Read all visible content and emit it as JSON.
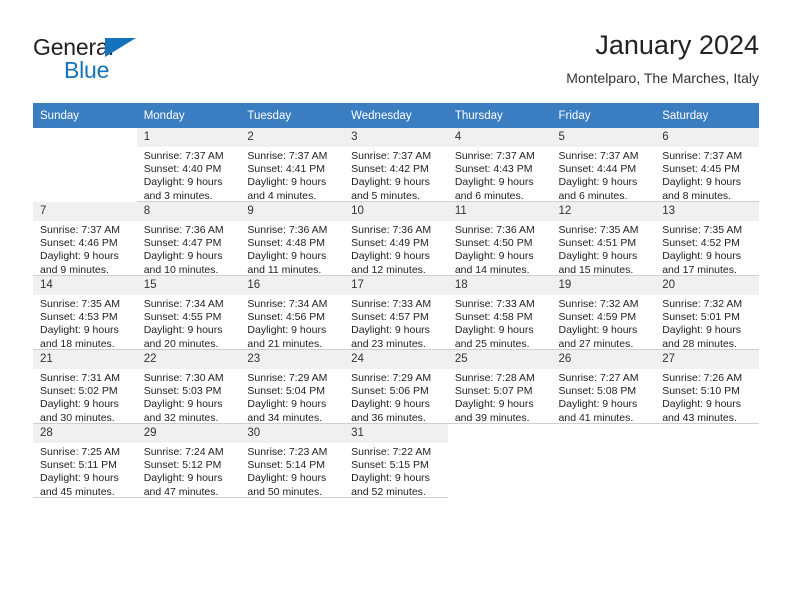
{
  "logo": {
    "word1": "General",
    "word2": "Blue"
  },
  "header": {
    "title": "January 2024",
    "subtitle": "Montelparo, The Marches, Italy"
  },
  "labels": {
    "sunrise_prefix": "Sunrise: ",
    "sunset_prefix": "Sunset: ",
    "daylight_prefix": "Daylight: "
  },
  "colors": {
    "header_blue": "#3a7dc0",
    "logo_blue": "#1673bb",
    "daynum_band": "#f0f0f0",
    "cell_border": "#cfcfcf"
  },
  "weekdays": [
    "Sunday",
    "Monday",
    "Tuesday",
    "Wednesday",
    "Thursday",
    "Friday",
    "Saturday"
  ],
  "weeks": [
    [
      {
        "day": "",
        "empty": true
      },
      {
        "day": "1",
        "sunrise": "Sunrise: 7:37 AM",
        "sunset": "Sunset: 4:40 PM",
        "daylight": "Daylight: 9 hours and 3 minutes."
      },
      {
        "day": "2",
        "sunrise": "Sunrise: 7:37 AM",
        "sunset": "Sunset: 4:41 PM",
        "daylight": "Daylight: 9 hours and 4 minutes."
      },
      {
        "day": "3",
        "sunrise": "Sunrise: 7:37 AM",
        "sunset": "Sunset: 4:42 PM",
        "daylight": "Daylight: 9 hours and 5 minutes."
      },
      {
        "day": "4",
        "sunrise": "Sunrise: 7:37 AM",
        "sunset": "Sunset: 4:43 PM",
        "daylight": "Daylight: 9 hours and 6 minutes."
      },
      {
        "day": "5",
        "sunrise": "Sunrise: 7:37 AM",
        "sunset": "Sunset: 4:44 PM",
        "daylight": "Daylight: 9 hours and 6 minutes."
      },
      {
        "day": "6",
        "sunrise": "Sunrise: 7:37 AM",
        "sunset": "Sunset: 4:45 PM",
        "daylight": "Daylight: 9 hours and 8 minutes."
      }
    ],
    [
      {
        "day": "7",
        "sunrise": "Sunrise: 7:37 AM",
        "sunset": "Sunset: 4:46 PM",
        "daylight": "Daylight: 9 hours and 9 minutes."
      },
      {
        "day": "8",
        "sunrise": "Sunrise: 7:36 AM",
        "sunset": "Sunset: 4:47 PM",
        "daylight": "Daylight: 9 hours and 10 minutes."
      },
      {
        "day": "9",
        "sunrise": "Sunrise: 7:36 AM",
        "sunset": "Sunset: 4:48 PM",
        "daylight": "Daylight: 9 hours and 11 minutes."
      },
      {
        "day": "10",
        "sunrise": "Sunrise: 7:36 AM",
        "sunset": "Sunset: 4:49 PM",
        "daylight": "Daylight: 9 hours and 12 minutes."
      },
      {
        "day": "11",
        "sunrise": "Sunrise: 7:36 AM",
        "sunset": "Sunset: 4:50 PM",
        "daylight": "Daylight: 9 hours and 14 minutes."
      },
      {
        "day": "12",
        "sunrise": "Sunrise: 7:35 AM",
        "sunset": "Sunset: 4:51 PM",
        "daylight": "Daylight: 9 hours and 15 minutes."
      },
      {
        "day": "13",
        "sunrise": "Sunrise: 7:35 AM",
        "sunset": "Sunset: 4:52 PM",
        "daylight": "Daylight: 9 hours and 17 minutes."
      }
    ],
    [
      {
        "day": "14",
        "sunrise": "Sunrise: 7:35 AM",
        "sunset": "Sunset: 4:53 PM",
        "daylight": "Daylight: 9 hours and 18 minutes."
      },
      {
        "day": "15",
        "sunrise": "Sunrise: 7:34 AM",
        "sunset": "Sunset: 4:55 PM",
        "daylight": "Daylight: 9 hours and 20 minutes."
      },
      {
        "day": "16",
        "sunrise": "Sunrise: 7:34 AM",
        "sunset": "Sunset: 4:56 PM",
        "daylight": "Daylight: 9 hours and 21 minutes."
      },
      {
        "day": "17",
        "sunrise": "Sunrise: 7:33 AM",
        "sunset": "Sunset: 4:57 PM",
        "daylight": "Daylight: 9 hours and 23 minutes."
      },
      {
        "day": "18",
        "sunrise": "Sunrise: 7:33 AM",
        "sunset": "Sunset: 4:58 PM",
        "daylight": "Daylight: 9 hours and 25 minutes."
      },
      {
        "day": "19",
        "sunrise": "Sunrise: 7:32 AM",
        "sunset": "Sunset: 4:59 PM",
        "daylight": "Daylight: 9 hours and 27 minutes."
      },
      {
        "day": "20",
        "sunrise": "Sunrise: 7:32 AM",
        "sunset": "Sunset: 5:01 PM",
        "daylight": "Daylight: 9 hours and 28 minutes."
      }
    ],
    [
      {
        "day": "21",
        "sunrise": "Sunrise: 7:31 AM",
        "sunset": "Sunset: 5:02 PM",
        "daylight": "Daylight: 9 hours and 30 minutes."
      },
      {
        "day": "22",
        "sunrise": "Sunrise: 7:30 AM",
        "sunset": "Sunset: 5:03 PM",
        "daylight": "Daylight: 9 hours and 32 minutes."
      },
      {
        "day": "23",
        "sunrise": "Sunrise: 7:29 AM",
        "sunset": "Sunset: 5:04 PM",
        "daylight": "Daylight: 9 hours and 34 minutes."
      },
      {
        "day": "24",
        "sunrise": "Sunrise: 7:29 AM",
        "sunset": "Sunset: 5:06 PM",
        "daylight": "Daylight: 9 hours and 36 minutes."
      },
      {
        "day": "25",
        "sunrise": "Sunrise: 7:28 AM",
        "sunset": "Sunset: 5:07 PM",
        "daylight": "Daylight: 9 hours and 39 minutes."
      },
      {
        "day": "26",
        "sunrise": "Sunrise: 7:27 AM",
        "sunset": "Sunset: 5:08 PM",
        "daylight": "Daylight: 9 hours and 41 minutes."
      },
      {
        "day": "27",
        "sunrise": "Sunrise: 7:26 AM",
        "sunset": "Sunset: 5:10 PM",
        "daylight": "Daylight: 9 hours and 43 minutes."
      }
    ],
    [
      {
        "day": "28",
        "sunrise": "Sunrise: 7:25 AM",
        "sunset": "Sunset: 5:11 PM",
        "daylight": "Daylight: 9 hours and 45 minutes."
      },
      {
        "day": "29",
        "sunrise": "Sunrise: 7:24 AM",
        "sunset": "Sunset: 5:12 PM",
        "daylight": "Daylight: 9 hours and 47 minutes."
      },
      {
        "day": "30",
        "sunrise": "Sunrise: 7:23 AM",
        "sunset": "Sunset: 5:14 PM",
        "daylight": "Daylight: 9 hours and 50 minutes."
      },
      {
        "day": "31",
        "sunrise": "Sunrise: 7:22 AM",
        "sunset": "Sunset: 5:15 PM",
        "daylight": "Daylight: 9 hours and 52 minutes."
      },
      {
        "day": "",
        "empty": true
      },
      {
        "day": "",
        "empty": true
      },
      {
        "day": "",
        "empty": true
      }
    ]
  ]
}
